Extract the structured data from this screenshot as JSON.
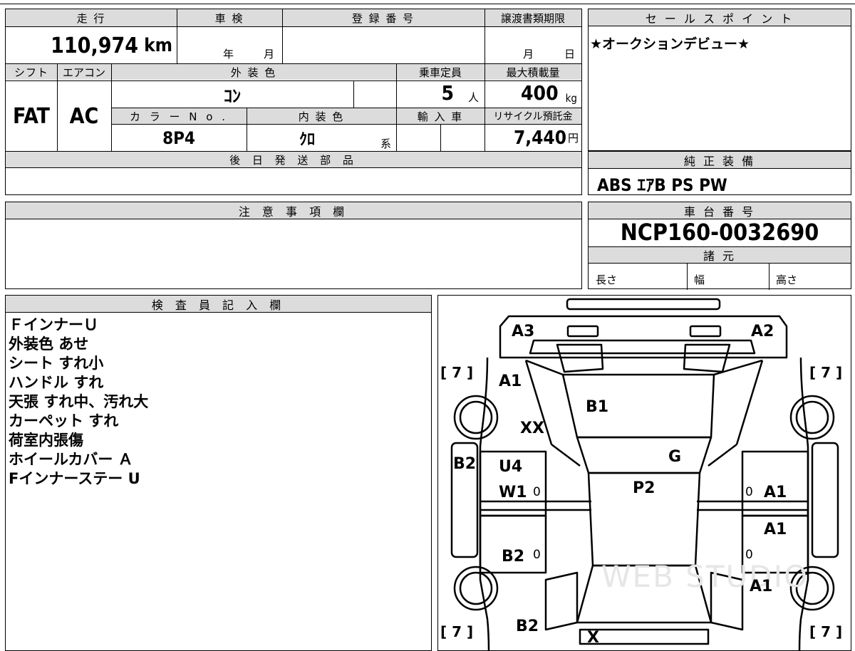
{
  "vehicle": {
    "mileage_label": "走 行",
    "mileage_value": "110,974",
    "mileage_unit": "km",
    "shaken_label": "車 検",
    "shaken_year": "年",
    "shaken_month": "月",
    "registration_label": "登 録 番 号",
    "transfer_label": "譲渡書類期限",
    "transfer_month": "月",
    "transfer_day": "日",
    "shift_label": "シフト",
    "shift_value": "FAT",
    "ac_label": "エアコン",
    "ac_value": "AC",
    "exterior_label": "外 装 色",
    "exterior_value": "ｺﾝ",
    "capacity_label": "乗車定員",
    "capacity_value": "5",
    "capacity_unit": "人",
    "maxload_label": "最大積載量",
    "maxload_value": "400",
    "maxload_unit": "kg",
    "color_no_label": "カ ラ ー N o .",
    "color_no_value": "8P4",
    "interior_label": "内 装 色",
    "interior_value": "ｸﾛ",
    "interior_suffix": "系",
    "import_label": "輸 入 車",
    "recycle_label": "リサイクル預託金",
    "recycle_value": "7,440",
    "recycle_unit": "円",
    "later_parts_label": "後 日 発 送 部 品"
  },
  "sales_point": {
    "label": "セ ー ル ス ポ イ ン ト",
    "text": "★オークションデビュー★"
  },
  "equipment": {
    "label": "純 正 装 備",
    "value": "ABS ｴｱB PS PW"
  },
  "notes": {
    "label": "注 意 事 項 欄"
  },
  "chassis": {
    "label": "車 台 番 号",
    "value": "NCP160-0032690",
    "specs_label": "諸 元",
    "length_label": "長さ",
    "width_label": "幅",
    "height_label": "高さ"
  },
  "inspector": {
    "label": "検 査 員 記 入 欄",
    "lines": [
      "ＦインナーＵ",
      "外装色 あせ",
      "シート すれ小",
      "ハンドル すれ",
      "天張 すれ中、汚れ大",
      "カーペット すれ",
      "荷室内張傷",
      "ホイールカバー Ａ",
      "Fインナーステー U"
    ]
  },
  "diagram": {
    "marks": {
      "a3": "A3",
      "a2": "A2",
      "a1_front_left": "A1",
      "a1_right_door_front": "A1",
      "a1_right_door_rear": "A1",
      "a1_rear_right": "A1",
      "b1": "B1",
      "xx": "XX",
      "g": "G",
      "b2_left_side": "B2",
      "u4": "U4",
      "w1": "W1",
      "p2": "P2",
      "b2_left_rear": "B2",
      "b2_rear": "B2",
      "x_rear": "X",
      "zero": "0",
      "tire_fl": "[ 7 ]",
      "tire_fr": "[ 7 ]",
      "tire_rl": "[ 7 ]",
      "tire_rr": "[ 7 ]"
    },
    "watermark": "WEB STUDIO"
  }
}
